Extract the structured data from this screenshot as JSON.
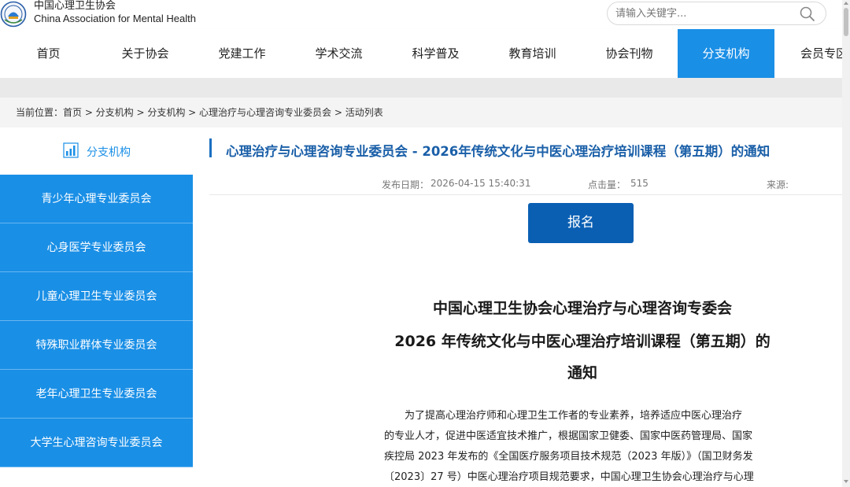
{
  "header": {
    "org_cn": "中国心理卫生协会",
    "org_en": "China Association for Mental Health",
    "search_placeholder": "请输入关键字..."
  },
  "nav": {
    "items": [
      "首页",
      "关于协会",
      "党建工作",
      "学术交流",
      "科学普及",
      "教育培训",
      "协会刊物",
      "分支机构",
      "会员专区"
    ],
    "active": "分支机构"
  },
  "breadcrumb": "当前位置：首页 > 分支机构 > 分支机构 > 心理治疗与心理咨询专业委员会 > 活动列表",
  "sidebar": {
    "heading": "分支机构",
    "items": [
      "青少年心理专业委员会",
      "心身医学专业委员会",
      "儿童心理卫生专业委员会",
      "特殊职业群体专业委员会",
      "老年心理卫生专业委员会",
      "大学生心理咨询专业委员会"
    ]
  },
  "article": {
    "title": "心理治疗与心理咨询专业委员会 - 2026年传统文化与中医心理治疗培训课程（第五期）的通知",
    "date_label": "发布日期：",
    "date": "2026-04-15 15:40:31",
    "clicks_label": "点击量：",
    "clicks": "515",
    "source_label": "来源:",
    "signup_label": "报名",
    "doc_title": [
      "中国心理卫生协会心理治疗与心理咨询专委会",
      "2026 年传统文化与中医心理治疗培训课程（第五期）的",
      "通知"
    ],
    "body": [
      "为了提高心理治疗师和心理卫生工作者的专业素养，培养适应中医心理治疗",
      "的专业人才，促进中医适宜技术推广，根据国家卫健委、国家中医药管理局、国家",
      "疾控局 2023 年发布的《全国医疗服务项目技术规范（2023 年版）》（国卫财务发",
      "〔2023〕27 号）中医心理治疗项目规范要求，中国心理卫生协会心理治疗与心理"
    ]
  },
  "colors": {
    "accent": "#1a8fe6",
    "title": "#1a5fa8",
    "button": "#0a5fb3"
  }
}
